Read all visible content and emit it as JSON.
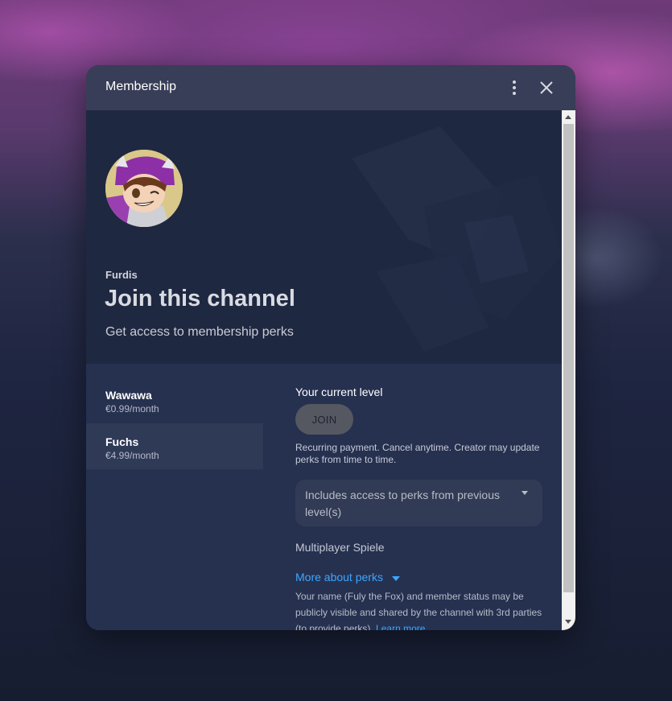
{
  "dialog": {
    "title": "Membership",
    "more_icon": "more-vert-icon",
    "close_icon": "close-icon"
  },
  "banner": {
    "channel_name": "Furdis",
    "heading": "Join this channel",
    "subheading": "Get access to membership perks",
    "avatar_icon": "channel-avatar"
  },
  "tiers": [
    {
      "name": "Wawawa",
      "price": "€0.99/month",
      "selected": false
    },
    {
      "name": "Fuchs",
      "price": "€4.99/month",
      "selected": true
    }
  ],
  "details": {
    "current_level_label": "Your current level",
    "join_label": "JOIN",
    "recurring_text": "Recurring payment. Cancel anytime. Creator may update perks from time to time.",
    "includes_text": "Includes access to perks from previous level(s)",
    "perk": "Multiplayer Spiele",
    "more_perks_label": "More about perks",
    "privacy_text": "Your name (Fuly the Fox) and member status may be publicly visible and shared by the channel with 3rd parties (to provide perks).",
    "learn_more_label": "Learn more"
  },
  "colors": {
    "accent": "#3ea6ff",
    "header_bg": "#383d58",
    "dialog_bg": "#263048",
    "join_button_bg": "#555860"
  }
}
